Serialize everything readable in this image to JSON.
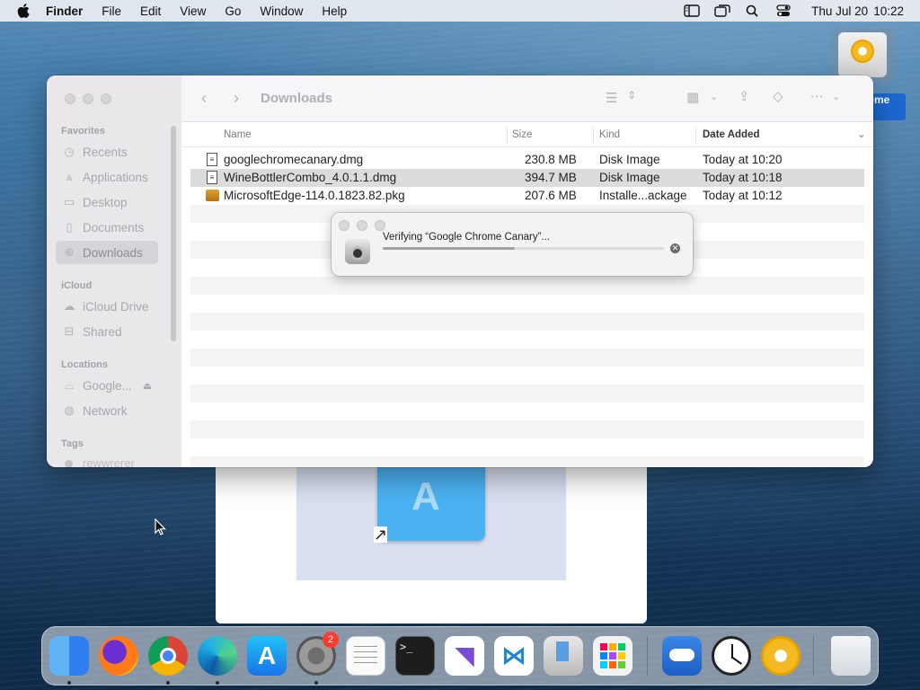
{
  "menubar": {
    "app_name": "Finder",
    "items": [
      "File",
      "Edit",
      "View",
      "Go",
      "Window",
      "Help"
    ],
    "clock": {
      "date": "Thu Jul 20",
      "time": "10:22"
    }
  },
  "desktop_icon": {
    "label": "...rome\ny"
  },
  "finder": {
    "title": "Downloads",
    "sidebar": {
      "favorites_header": "Favorites",
      "favorites": [
        {
          "label": "Recents",
          "icon": "clock-icon"
        },
        {
          "label": "Applications",
          "icon": "applications-icon"
        },
        {
          "label": "Desktop",
          "icon": "desktop-icon"
        },
        {
          "label": "Documents",
          "icon": "document-icon"
        },
        {
          "label": "Downloads",
          "icon": "download-icon",
          "selected": true
        }
      ],
      "icloud_header": "iCloud",
      "icloud": [
        {
          "label": "iCloud Drive",
          "icon": "cloud-icon"
        },
        {
          "label": "Shared",
          "icon": "shared-folder-icon"
        }
      ],
      "locations_header": "Locations",
      "locations": [
        {
          "label": "Google...",
          "icon": "disk-icon"
        },
        {
          "label": "Network",
          "icon": "globe-icon"
        }
      ],
      "tags_header": "Tags",
      "tags": [
        {
          "label": "rewwrerer"
        }
      ]
    },
    "columns": {
      "name": "Name",
      "size": "Size",
      "kind": "Kind",
      "date_added": "Date Added"
    },
    "files": [
      {
        "name": "googlechromecanary.dmg",
        "size": "230.8 MB",
        "kind": "Disk Image",
        "date": "Today at 10:20"
      },
      {
        "name": "WineBottlerCombo_4.0.1.1.dmg",
        "size": "394.7 MB",
        "kind": "Disk Image",
        "date": "Today at 10:18"
      },
      {
        "name": "MicrosoftEdge-114.0.1823.82.pkg",
        "size": "207.6 MB",
        "kind": "Installe...ackage",
        "date": "Today at 10:12"
      }
    ]
  },
  "verify_dialog": {
    "message": "Verifying “Google Chrome Canary”...",
    "progress": 0.47
  },
  "dock": {
    "apps": [
      "finder",
      "firefox",
      "chrome",
      "edge",
      "app-store",
      "system-settings",
      "textedit",
      "terminal",
      "visual-studio",
      "vscode",
      "installer",
      "launchpad",
      "weather",
      "clock",
      "chrome-canary",
      "trash"
    ],
    "settings_badge": "2"
  }
}
